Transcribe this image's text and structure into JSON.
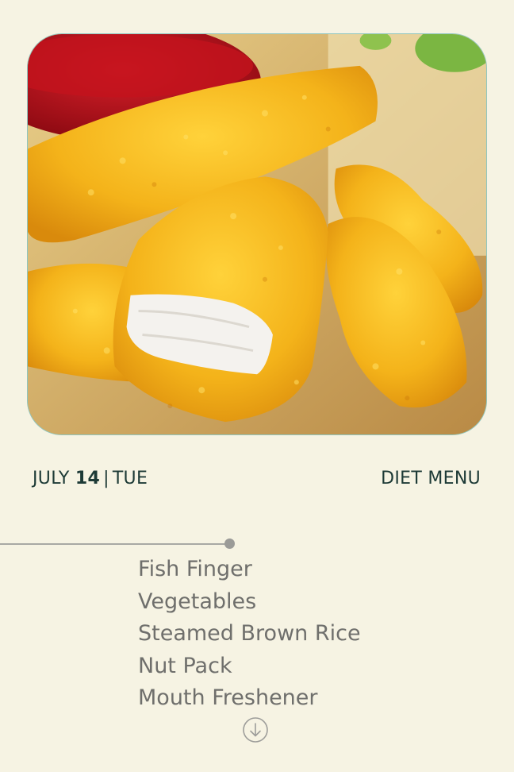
{
  "hero": {
    "image_subject": "fish-fingers-photo"
  },
  "date": {
    "month": "JULY",
    "day": "14",
    "separator": "|",
    "weekday": "TUE"
  },
  "menu": {
    "title": "DIET MENU",
    "items": [
      "Fish Finger",
      "Vegetables",
      "Steamed Brown Rice",
      "Nut Pack",
      "Mouth Freshener"
    ]
  },
  "icons": {
    "scroll": "arrow-down-circle-icon"
  },
  "colors": {
    "background": "#f6f3e3",
    "heading": "#1d3a36",
    "item_text": "#6f6f6c",
    "border_accent": "#8fc6c0"
  }
}
